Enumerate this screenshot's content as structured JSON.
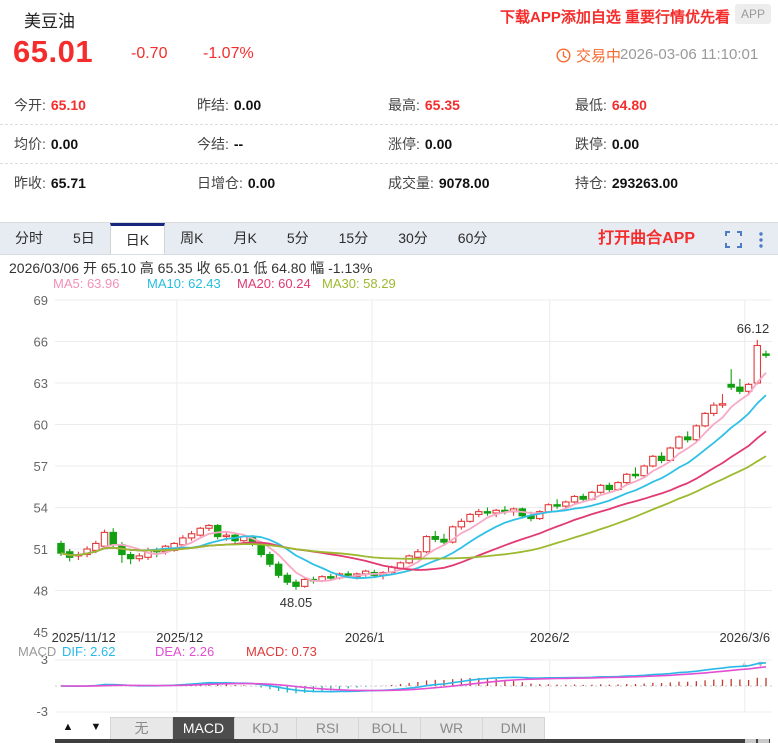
{
  "header": {
    "title": "美豆油",
    "promo": "下载APP添加自选 重要行情优先看",
    "app_badge": "APP",
    "price": "65.01",
    "change": "-0.70",
    "change_pct": "-1.07%",
    "status": "交易中",
    "timestamp": "2026-03-06 11:10:01"
  },
  "quote_grid": {
    "rows": [
      [
        {
          "label": "今开:",
          "value": "65.10",
          "color": "red"
        },
        {
          "label": "昨结:",
          "value": "0.00",
          "color": "black"
        },
        {
          "label": "最高:",
          "value": "65.35",
          "color": "red"
        },
        {
          "label": "最低:",
          "value": "64.80",
          "color": "red"
        }
      ],
      [
        {
          "label": "均价:",
          "value": "0.00",
          "color": "black"
        },
        {
          "label": "今结:",
          "value": "--",
          "color": "black"
        },
        {
          "label": "涨停:",
          "value": "0.00",
          "color": "black"
        },
        {
          "label": "跌停:",
          "value": "0.00",
          "color": "black"
        }
      ],
      [
        {
          "label": "昨收:",
          "value": "65.71",
          "color": "black"
        },
        {
          "label": "日增仓:",
          "value": "0.00",
          "color": "black"
        },
        {
          "label": "成交量:",
          "value": "9078.00",
          "color": "black"
        },
        {
          "label": "持仓:",
          "value": "293263.00",
          "color": "black"
        }
      ]
    ]
  },
  "period_tabs": {
    "items": [
      "分时",
      "5日",
      "日K",
      "周K",
      "月K",
      "5分",
      "15分",
      "30分",
      "60分"
    ],
    "active": "日K",
    "open_app_label": "打开曲合APP"
  },
  "kline_info": "2026/03/06 开 65.10 高 65.35 收 65.01 低 64.80 幅 -1.13%",
  "ma_legend": [
    {
      "text": "MA5: 63.96",
      "color": "#f490b8"
    },
    {
      "text": "MA10: 62.43",
      "color": "#26bde2"
    },
    {
      "text": "MA20: 60.24",
      "color": "#e23a72"
    },
    {
      "text": "MA30: 58.29",
      "color": "#9cba30"
    }
  ],
  "chart_data": {
    "type": "candlestick",
    "title": "美豆油 日K",
    "ylim": [
      45,
      69
    ],
    "y_ticks": [
      69,
      66,
      63,
      60,
      57,
      54,
      51,
      48,
      45
    ],
    "grid_x_fractions": [
      0.17,
      0.442,
      0.69,
      0.962
    ],
    "x_labels": [
      {
        "text": "2025/11/12",
        "frac": 0.04
      },
      {
        "text": "2025/12",
        "frac": 0.174
      },
      {
        "text": "2026/1",
        "frac": 0.432
      },
      {
        "text": "2026/2",
        "frac": 0.69
      },
      {
        "text": "2026/3/6",
        "frac": 0.962
      }
    ],
    "annotations": [
      {
        "text": "66.12",
        "index": 80,
        "value": 66.12,
        "placement": "above"
      },
      {
        "text": "48.05",
        "index": 27,
        "value": 48.05,
        "placement": "below"
      }
    ],
    "up_color": "#e23b3b",
    "down_color": "#12a012",
    "ma_lines": [
      {
        "name": "MA5",
        "period": 5,
        "color": "#f8a9c6"
      },
      {
        "name": "MA10",
        "period": 10,
        "color": "#2fc0e6"
      },
      {
        "name": "MA20",
        "period": 20,
        "color": "#e23a72"
      },
      {
        "name": "MA30",
        "period": 30,
        "color": "#9cba30"
      }
    ],
    "candles": [
      [
        51.4,
        51.6,
        50.5,
        50.7
      ],
      [
        50.8,
        51.0,
        50.1,
        50.4
      ],
      [
        50.5,
        50.8,
        50.2,
        50.6
      ],
      [
        50.6,
        51.2,
        50.4,
        51.0
      ],
      [
        50.9,
        51.6,
        50.7,
        51.4
      ],
      [
        51.2,
        52.4,
        51.0,
        52.2
      ],
      [
        52.2,
        52.5,
        51.1,
        51.3
      ],
      [
        51.3,
        51.5,
        50.0,
        50.6
      ],
      [
        50.6,
        50.8,
        49.9,
        50.3
      ],
      [
        50.3,
        50.7,
        50.1,
        50.5
      ],
      [
        50.4,
        51.1,
        50.2,
        50.9
      ],
      [
        50.9,
        51.1,
        50.4,
        50.8
      ],
      [
        50.8,
        51.3,
        50.6,
        51.2
      ],
      [
        50.9,
        51.5,
        50.8,
        51.4
      ],
      [
        51.3,
        52.0,
        51.1,
        51.8
      ],
      [
        51.8,
        52.3,
        51.6,
        52.1
      ],
      [
        52.0,
        52.6,
        51.9,
        52.5
      ],
      [
        52.5,
        52.8,
        52.3,
        52.7
      ],
      [
        52.7,
        52.8,
        51.7,
        51.9
      ],
      [
        51.9,
        52.2,
        51.6,
        52.0
      ],
      [
        52.0,
        52.1,
        51.4,
        51.6
      ],
      [
        51.6,
        52.0,
        51.5,
        51.9
      ],
      [
        51.9,
        52.0,
        51.2,
        51.4
      ],
      [
        51.4,
        51.5,
        50.4,
        50.6
      ],
      [
        50.6,
        50.8,
        49.7,
        49.9
      ],
      [
        49.9,
        50.1,
        48.9,
        49.1
      ],
      [
        49.1,
        49.3,
        48.4,
        48.6
      ],
      [
        48.6,
        48.8,
        48.05,
        48.3
      ],
      [
        48.3,
        48.9,
        48.2,
        48.8
      ],
      [
        48.8,
        49.0,
        48.5,
        48.7
      ],
      [
        48.7,
        49.1,
        48.6,
        49.0
      ],
      [
        49.0,
        49.2,
        48.7,
        48.9
      ],
      [
        48.9,
        49.3,
        48.8,
        49.2
      ],
      [
        49.2,
        49.4,
        48.9,
        49.1
      ],
      [
        49.0,
        49.3,
        48.8,
        49.2
      ],
      [
        49.2,
        49.5,
        49.0,
        49.4
      ],
      [
        49.3,
        49.5,
        48.9,
        49.1
      ],
      [
        49.1,
        49.4,
        48.8,
        49.3
      ],
      [
        49.3,
        49.8,
        49.2,
        49.7
      ],
      [
        49.6,
        50.1,
        49.5,
        50.0
      ],
      [
        50.0,
        50.6,
        49.9,
        50.5
      ],
      [
        50.4,
        51.0,
        50.3,
        50.8
      ],
      [
        50.8,
        52.0,
        50.7,
        51.9
      ],
      [
        51.9,
        52.3,
        51.5,
        51.7
      ],
      [
        51.7,
        52.1,
        51.3,
        51.5
      ],
      [
        51.5,
        52.7,
        51.4,
        52.6
      ],
      [
        52.6,
        53.2,
        52.4,
        53.0
      ],
      [
        53.0,
        53.6,
        52.9,
        53.5
      ],
      [
        53.5,
        53.9,
        53.3,
        53.7
      ],
      [
        53.7,
        54.0,
        53.4,
        53.6
      ],
      [
        53.6,
        53.9,
        53.3,
        53.8
      ],
      [
        53.8,
        54.1,
        53.5,
        53.7
      ],
      [
        53.7,
        54.0,
        53.4,
        53.9
      ],
      [
        53.9,
        54.0,
        53.2,
        53.4
      ],
      [
        53.4,
        53.7,
        53.0,
        53.2
      ],
      [
        53.2,
        53.8,
        53.1,
        53.7
      ],
      [
        53.7,
        54.3,
        53.6,
        54.2
      ],
      [
        54.2,
        54.6,
        53.9,
        54.1
      ],
      [
        54.1,
        54.5,
        54.0,
        54.4
      ],
      [
        54.4,
        54.9,
        54.3,
        54.8
      ],
      [
        54.8,
        55.0,
        54.4,
        54.6
      ],
      [
        54.6,
        55.2,
        54.5,
        55.1
      ],
      [
        55.1,
        55.7,
        55.0,
        55.6
      ],
      [
        55.6,
        55.8,
        55.1,
        55.3
      ],
      [
        55.3,
        55.9,
        55.2,
        55.8
      ],
      [
        55.8,
        56.5,
        55.7,
        56.4
      ],
      [
        56.4,
        56.9,
        56.1,
        56.3
      ],
      [
        56.3,
        57.1,
        56.2,
        57.0
      ],
      [
        57.0,
        57.8,
        56.9,
        57.7
      ],
      [
        57.7,
        58.0,
        57.2,
        57.4
      ],
      [
        57.4,
        58.4,
        57.3,
        58.3
      ],
      [
        58.3,
        59.2,
        58.2,
        59.1
      ],
      [
        59.1,
        59.5,
        58.7,
        58.9
      ],
      [
        58.9,
        60.0,
        58.8,
        59.9
      ],
      [
        59.9,
        60.9,
        59.8,
        60.8
      ],
      [
        60.8,
        61.6,
        60.6,
        61.4
      ],
      [
        61.4,
        62.2,
        61.2,
        61.5
      ],
      [
        62.9,
        64.0,
        62.5,
        62.7
      ],
      [
        62.7,
        63.3,
        62.2,
        62.4
      ],
      [
        62.4,
        63.0,
        62.1,
        62.9
      ],
      [
        63.0,
        66.12,
        62.9,
        65.71
      ],
      [
        65.1,
        65.35,
        64.8,
        65.01
      ]
    ]
  },
  "macd_panel": {
    "label": "MACD",
    "dif_text": "DIF: 2.62",
    "dea_text": "DEA: 2.26",
    "macd_text": "MACD: 0.73",
    "dif_color": "#29b9e8",
    "dea_color": "#e24fd2",
    "macd_color": "#e03a3a",
    "hist_up_color": "#c03a30",
    "hist_down_color": "#25b2ac",
    "ylim": [
      -3,
      3
    ],
    "y_tick_top": "3",
    "y_tick_bottom": "-3",
    "scroll_up": "▲",
    "scroll_down": "▼"
  },
  "bottom_bar": {
    "up": "▲",
    "down": "▼",
    "tabs": [
      "无",
      "MACD",
      "KDJ",
      "RSI",
      "BOLL",
      "WR",
      "DMI"
    ],
    "active": "MACD"
  }
}
